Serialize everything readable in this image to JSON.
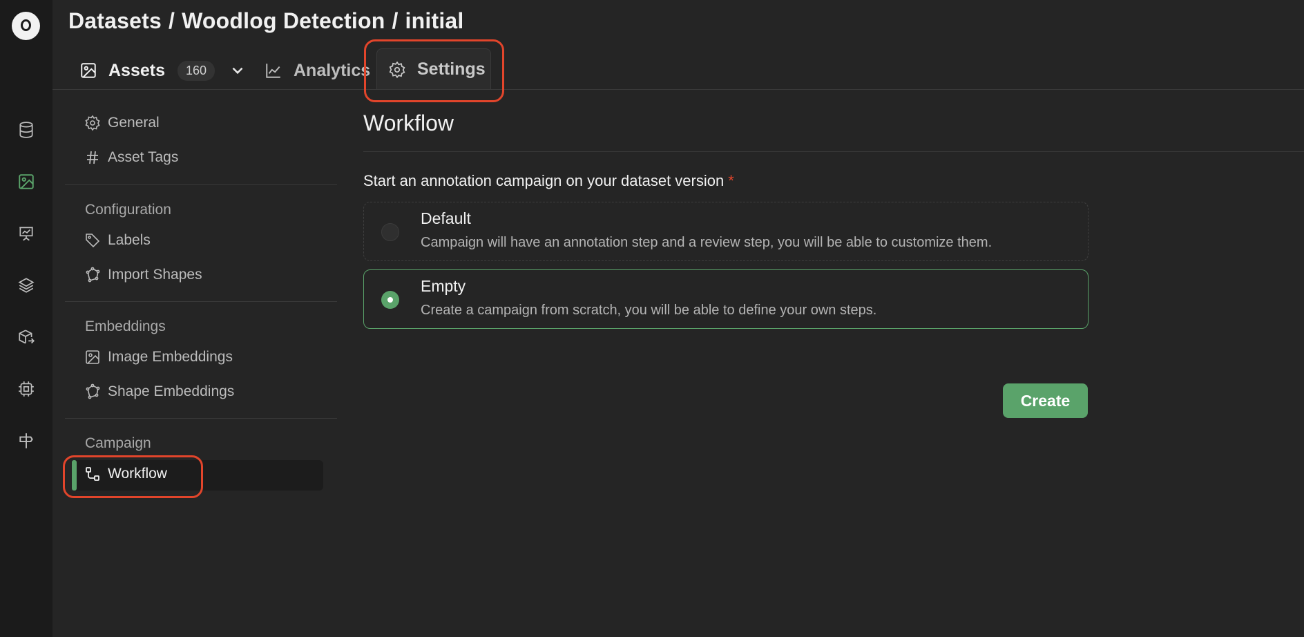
{
  "breadcrumb": {
    "root": "Datasets",
    "dataset": "Woodlog Detection",
    "version": "initial",
    "separator": "/"
  },
  "tabs": {
    "assets": {
      "label": "Assets",
      "count": "160",
      "icon": "image-icon"
    },
    "analytics": {
      "label": "Analytics",
      "icon": "chart-line-icon"
    },
    "settings": {
      "label": "Settings",
      "icon": "gear-icon",
      "active": true
    }
  },
  "rail": {
    "items": [
      "logo",
      "database-icon",
      "image-icon",
      "presentation-chart-icon",
      "layers-icon",
      "model-export-icon",
      "cpu-icon",
      "signpost-icon"
    ],
    "active": "image-icon"
  },
  "sidebar": {
    "items": [
      {
        "label": "General",
        "icon": "gear-icon"
      },
      {
        "label": "Asset Tags",
        "icon": "hash-icon"
      }
    ],
    "sections": [
      {
        "title": "Configuration",
        "items": [
          {
            "label": "Labels",
            "icon": "tag-icon"
          },
          {
            "label": "Import Shapes",
            "icon": "polygon-icon"
          }
        ]
      },
      {
        "title": "Embeddings",
        "items": [
          {
            "label": "Image Embeddings",
            "icon": "image-icon"
          },
          {
            "label": "Shape Embeddings",
            "icon": "polygon-icon"
          }
        ]
      },
      {
        "title": "Campaign",
        "items": [
          {
            "label": "Workflow",
            "icon": "workflow-icon",
            "active": true
          }
        ]
      }
    ]
  },
  "main": {
    "title": "Workflow",
    "prompt": "Start an annotation campaign on your dataset version",
    "required_marker": "*",
    "options": [
      {
        "title": "Default",
        "description": "Campaign will have an annotation step and a review step, you will be able to customize them.",
        "selected": false
      },
      {
        "title": "Empty",
        "description": "Create a campaign from scratch, you will be able to define your own steps.",
        "selected": true
      }
    ],
    "create_label": "Create"
  },
  "colors": {
    "accent": "#5aa36a",
    "highlight": "#e2452b",
    "background": "#252525",
    "rail": "#1b1b1b"
  }
}
